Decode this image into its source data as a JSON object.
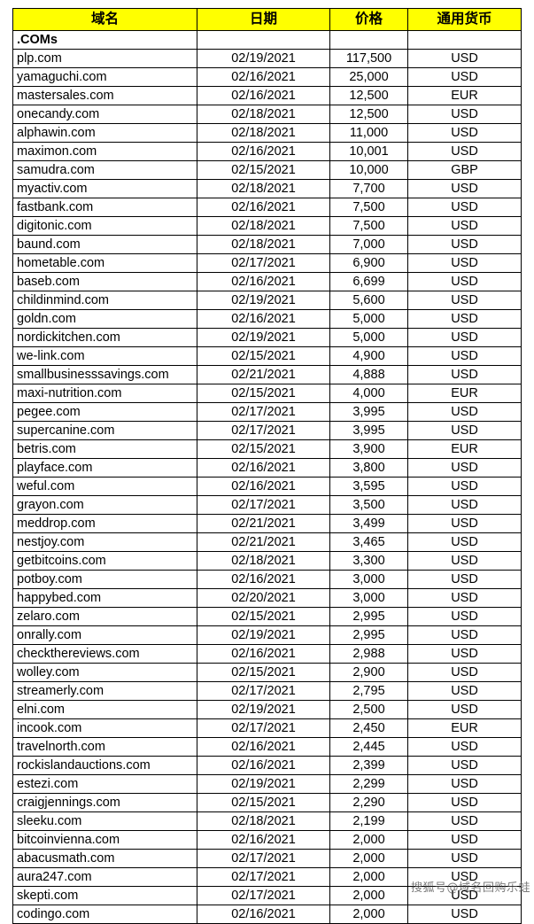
{
  "table": {
    "columns": [
      {
        "key": "domain",
        "label": "域名"
      },
      {
        "key": "date",
        "label": "日期"
      },
      {
        "key": "price",
        "label": "价格"
      },
      {
        "key": "currency",
        "label": "通用货币"
      }
    ],
    "header_background": "#FFFF00",
    "section_label": ".COMs",
    "rows": [
      {
        "domain": ".COMs",
        "date": "",
        "price": "",
        "currency": "",
        "section": true
      },
      {
        "domain": "plp.com",
        "date": "02/19/2021",
        "price": "117,500",
        "currency": "USD"
      },
      {
        "domain": "yamaguchi.com",
        "date": "02/16/2021",
        "price": "25,000",
        "currency": "USD"
      },
      {
        "domain": "mastersales.com",
        "date": "02/16/2021",
        "price": "12,500",
        "currency": "EUR"
      },
      {
        "domain": "onecandy.com",
        "date": "02/18/2021",
        "price": "12,500",
        "currency": "USD"
      },
      {
        "domain": "alphawin.com",
        "date": "02/18/2021",
        "price": "11,000",
        "currency": "USD"
      },
      {
        "domain": "maximon.com",
        "date": "02/16/2021",
        "price": "10,001",
        "currency": "USD"
      },
      {
        "domain": "samudra.com",
        "date": "02/15/2021",
        "price": "10,000",
        "currency": "GBP"
      },
      {
        "domain": "myactiv.com",
        "date": "02/18/2021",
        "price": "7,700",
        "currency": "USD"
      },
      {
        "domain": "fastbank.com",
        "date": "02/16/2021",
        "price": "7,500",
        "currency": "USD"
      },
      {
        "domain": "digitonic.com",
        "date": "02/18/2021",
        "price": "7,500",
        "currency": "USD"
      },
      {
        "domain": "baund.com",
        "date": "02/18/2021",
        "price": "7,000",
        "currency": "USD"
      },
      {
        "domain": "hometable.com",
        "date": "02/17/2021",
        "price": "6,900",
        "currency": "USD"
      },
      {
        "domain": "baseb.com",
        "date": "02/16/2021",
        "price": "6,699",
        "currency": "USD"
      },
      {
        "domain": "childinmind.com",
        "date": "02/19/2021",
        "price": "5,600",
        "currency": "USD"
      },
      {
        "domain": "goldn.com",
        "date": "02/16/2021",
        "price": "5,000",
        "currency": "USD"
      },
      {
        "domain": "nordickitchen.com",
        "date": "02/19/2021",
        "price": "5,000",
        "currency": "USD"
      },
      {
        "domain": "we-link.com",
        "date": "02/15/2021",
        "price": "4,900",
        "currency": "USD"
      },
      {
        "domain": "smallbusinesssavings.com",
        "date": "02/21/2021",
        "price": "4,888",
        "currency": "USD"
      },
      {
        "domain": "maxi-nutrition.com",
        "date": "02/15/2021",
        "price": "4,000",
        "currency": "EUR"
      },
      {
        "domain": "pegee.com",
        "date": "02/17/2021",
        "price": "3,995",
        "currency": "USD"
      },
      {
        "domain": "supercanine.com",
        "date": "02/17/2021",
        "price": "3,995",
        "currency": "USD"
      },
      {
        "domain": "betris.com",
        "date": "02/15/2021",
        "price": "3,900",
        "currency": "EUR"
      },
      {
        "domain": "playface.com",
        "date": "02/16/2021",
        "price": "3,800",
        "currency": "USD"
      },
      {
        "domain": "weful.com",
        "date": "02/16/2021",
        "price": "3,595",
        "currency": "USD"
      },
      {
        "domain": "grayon.com",
        "date": "02/17/2021",
        "price": "3,500",
        "currency": "USD"
      },
      {
        "domain": "meddrop.com",
        "date": "02/21/2021",
        "price": "3,499",
        "currency": "USD"
      },
      {
        "domain": "nestjoy.com",
        "date": "02/21/2021",
        "price": "3,465",
        "currency": "USD"
      },
      {
        "domain": "getbitcoins.com",
        "date": "02/18/2021",
        "price": "3,300",
        "currency": "USD"
      },
      {
        "domain": "potboy.com",
        "date": "02/16/2021",
        "price": "3,000",
        "currency": "USD"
      },
      {
        "domain": "happybed.com",
        "date": "02/20/2021",
        "price": "3,000",
        "currency": "USD"
      },
      {
        "domain": "zelaro.com",
        "date": "02/15/2021",
        "price": "2,995",
        "currency": "USD"
      },
      {
        "domain": "onrally.com",
        "date": "02/19/2021",
        "price": "2,995",
        "currency": "USD"
      },
      {
        "domain": "checkthereviews.com",
        "date": "02/16/2021",
        "price": "2,988",
        "currency": "USD"
      },
      {
        "domain": "wolley.com",
        "date": "02/15/2021",
        "price": "2,900",
        "currency": "USD"
      },
      {
        "domain": "streamerly.com",
        "date": "02/17/2021",
        "price": "2,795",
        "currency": "USD"
      },
      {
        "domain": "elni.com",
        "date": "02/19/2021",
        "price": "2,500",
        "currency": "USD"
      },
      {
        "domain": "incook.com",
        "date": "02/17/2021",
        "price": "2,450",
        "currency": "EUR"
      },
      {
        "domain": "travelnorth.com",
        "date": "02/16/2021",
        "price": "2,445",
        "currency": "USD"
      },
      {
        "domain": "rockislandauctions.com",
        "date": "02/16/2021",
        "price": "2,399",
        "currency": "USD"
      },
      {
        "domain": "estezi.com",
        "date": "02/19/2021",
        "price": "2,299",
        "currency": "USD"
      },
      {
        "domain": "craigjennings.com",
        "date": "02/15/2021",
        "price": "2,290",
        "currency": "USD"
      },
      {
        "domain": "sleeku.com",
        "date": "02/18/2021",
        "price": "2,199",
        "currency": "USD"
      },
      {
        "domain": "bitcoinvienna.com",
        "date": "02/16/2021",
        "price": "2,000",
        "currency": "USD"
      },
      {
        "domain": "abacusmath.com",
        "date": "02/17/2021",
        "price": "2,000",
        "currency": "USD"
      },
      {
        "domain": "aura247.com",
        "date": "02/17/2021",
        "price": "2,000",
        "currency": "USD"
      },
      {
        "domain": "skepti.com",
        "date": "02/17/2021",
        "price": "2,000",
        "currency": "USD"
      },
      {
        "domain": "codingo.com",
        "date": "02/16/2021",
        "price": "2,000",
        "currency": "USD"
      }
    ]
  },
  "watermark": {
    "text": "搜狐号@域名回购乐蛙"
  }
}
